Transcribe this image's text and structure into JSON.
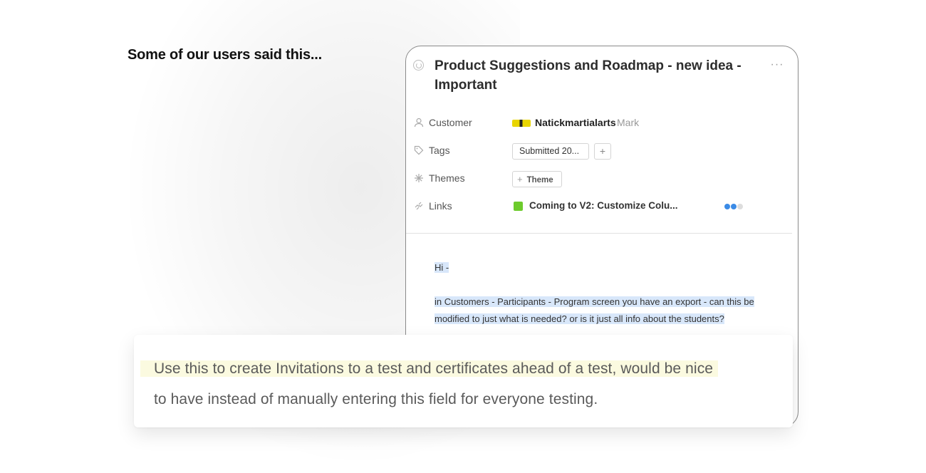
{
  "heading": "Some of our users said this...",
  "card": {
    "title": "Product Suggestions and Roadmap - new idea - Important",
    "more_label": "···",
    "properties": {
      "customer": {
        "label": "Customer",
        "name": "Natickmartialarts",
        "secondary": "Mark"
      },
      "tags": {
        "label": "Tags",
        "chip": "Submitted 20...",
        "add_label": "+"
      },
      "themes": {
        "label": "Themes",
        "add_label": "+",
        "button": "Theme"
      },
      "links": {
        "label": "Links",
        "item": "Coming to V2: Customize Colu...",
        "status_colors": [
          "#3b8be6",
          "#3b8be6",
          "#dddddd"
        ]
      }
    },
    "body": {
      "greeting": "Hi -",
      "line1": "in Customers - Participants - Program screen you have an export - can this be",
      "line2": "modified to just what is needed? or is it just all info about the students?"
    }
  },
  "quote": {
    "line1": "Use this to create Invitations to a test and certificates ahead of a test, would be nice",
    "line2": "to have instead of manually entering this field for everyone testing."
  },
  "colors": {
    "link_square": "#6dcb2c",
    "highlight_blue": "#d8e7fa",
    "highlight_yellow": "#fbfae0"
  }
}
